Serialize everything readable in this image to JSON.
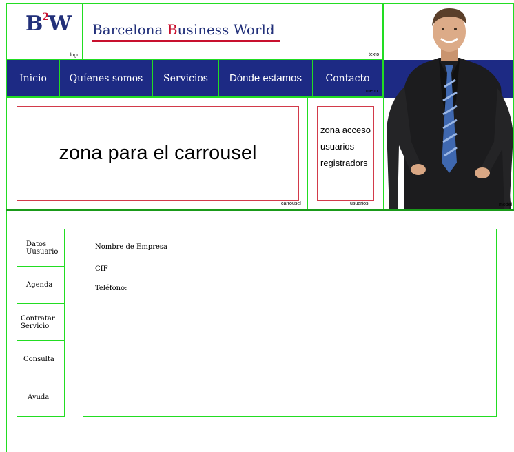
{
  "header": {
    "logo": {
      "text": "B²W",
      "letters": "BW",
      "superscript": "2",
      "caption": "logo"
    },
    "brand": {
      "part1": "Barcelona ",
      "b": "B",
      "part2": "usiness ",
      "w": "W",
      "part3": "orld"
    },
    "texto_caption": "texto"
  },
  "nav": {
    "items": [
      {
        "label": "Inicio"
      },
      {
        "label": "Quíenes somos"
      },
      {
        "label": "Servicios"
      },
      {
        "label": "Dónde estamos"
      },
      {
        "label": "Contacto"
      }
    ],
    "caption": "menu"
  },
  "carrousel": {
    "text": "zona para el carrousel",
    "caption": "carrousel"
  },
  "usuarios": {
    "lines": [
      "zona acceso",
      "usuarios",
      "registradors"
    ],
    "caption": "usuarios"
  },
  "model": {
    "caption": "model"
  },
  "side_menu": {
    "items": [
      {
        "label": "Datos\nUusuario"
      },
      {
        "label": "Agenda"
      },
      {
        "label": "Contratar\nServicio"
      },
      {
        "label": "Consulta"
      },
      {
        "label": "Ayuda"
      }
    ]
  },
  "content": {
    "fields": [
      "Nombre de Empresa",
      "CIF",
      "Teléfono:"
    ]
  },
  "colors": {
    "navy": "#1d2a84",
    "red": "#c8102e",
    "green": "#22dd22",
    "red_outline": "#d23a4a"
  }
}
